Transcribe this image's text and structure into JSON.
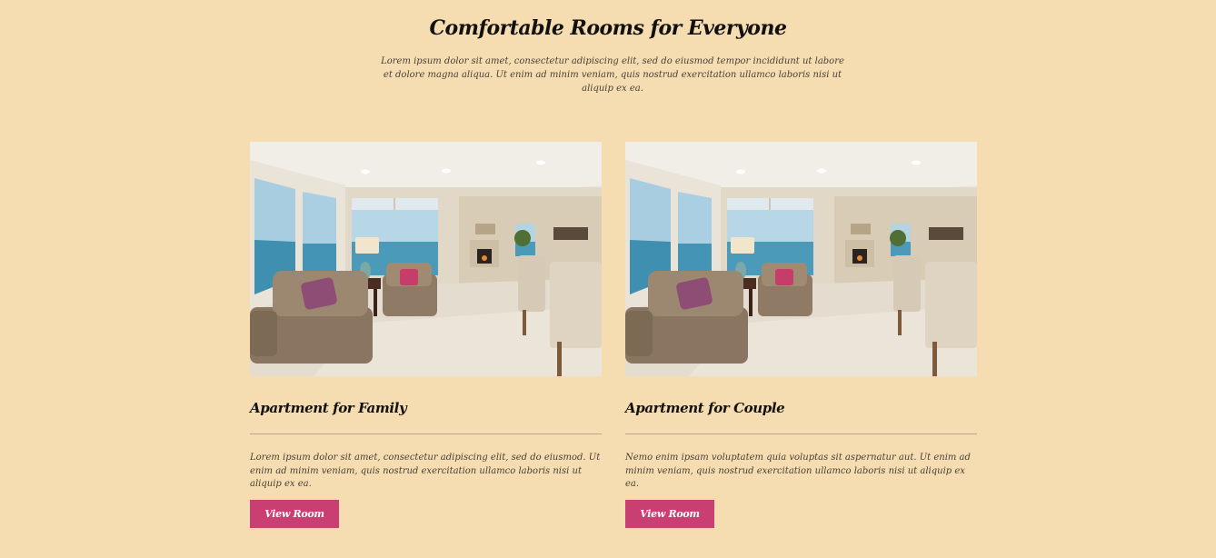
{
  "header": {
    "title": "Comfortable Rooms for Everyone",
    "subtitle": "Lorem ipsum dolor sit amet, consectetur adipiscing elit, sed do eiusmod tempor incididunt ut labore et dolore magna aliqua. Ut enim ad minim veniam, quis nostrud exercitation ullamco laboris nisi ut aliquip ex ea."
  },
  "rooms": [
    {
      "title": "Apartment for Family",
      "description": "Lorem ipsum dolor sit amet, consectetur adipiscing elit, sed do eiusmod. Ut enim ad minim veniam, quis nostrud exercitation ullamco laboris nisi ut aliquip ex ea.",
      "button_label": "View Room"
    },
    {
      "title": "Apartment for Couple",
      "description": "Nemo enim ipsam voluptatem quia voluptas sit aspernatur aut. Ut enim ad minim veniam, quis nostrud exercitation ullamco laboris nisi ut aliquip ex ea.",
      "button_label": "View Room"
    }
  ],
  "colors": {
    "background": "#f6ddb1",
    "button": "#c93f71",
    "divider": "#b7a58c"
  }
}
